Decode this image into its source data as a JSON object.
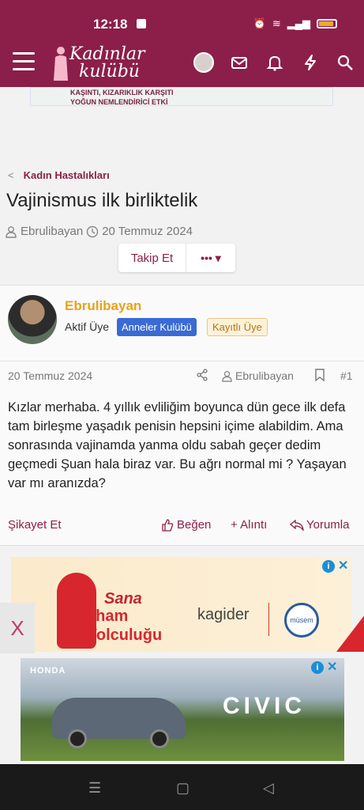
{
  "status": {
    "time": "12:18"
  },
  "site": {
    "logo_line1": "Kadınlar",
    "logo_line2": "kulübü"
  },
  "ad_strip": {
    "line1": "KAŞINTI, KIZARIKLIK KARŞITI",
    "line2": "YOĞUN NEMLENDİRİCİ ETKİ"
  },
  "breadcrumb": {
    "label": "Kadın Hastalıkları"
  },
  "thread": {
    "title": "Vajinismus ilk birliktelik",
    "author": "Ebrulibayan",
    "date": "20 Temmuz 2024",
    "follow_label": "Takip Et",
    "more_label": "•••"
  },
  "post": {
    "username": "Ebrulibayan",
    "role": "Aktif Üye",
    "badge1": "Anneler Kulübü",
    "badge2": "Kayıtlı Üye",
    "date": "20 Temmuz 2024",
    "author": "Ebrulibayan",
    "number": "#1",
    "body": "Kızlar merhaba. 4 yıllık evliliğim boyunca dün gece ilk defa tam birleşme yaşadık penisin hepsini içime alabildim. Ama sonrasında vajinamda yanma oldu sabah geçer dedim geçmedi Şuan hala biraz var. Bu ağrı normal mi ? Yaşayan var mı aranızda?",
    "report": "Şikayet Et",
    "like": "Beğen",
    "quote": "+ Alıntı",
    "reply": "Yorumla"
  },
  "ads": {
    "ad1": {
      "sana": "Sana",
      "ilham": "İlham",
      "yolculugu": "Yolculuğu",
      "kagider": "kagider",
      "musem": "müsem"
    },
    "close": "X",
    "ad2": {
      "brand": "HONDA",
      "model": "CIVIC"
    }
  },
  "colors": {
    "brand": "#8b1f49",
    "username": "#e8a21b",
    "badge_blue": "#3a6ad3"
  }
}
